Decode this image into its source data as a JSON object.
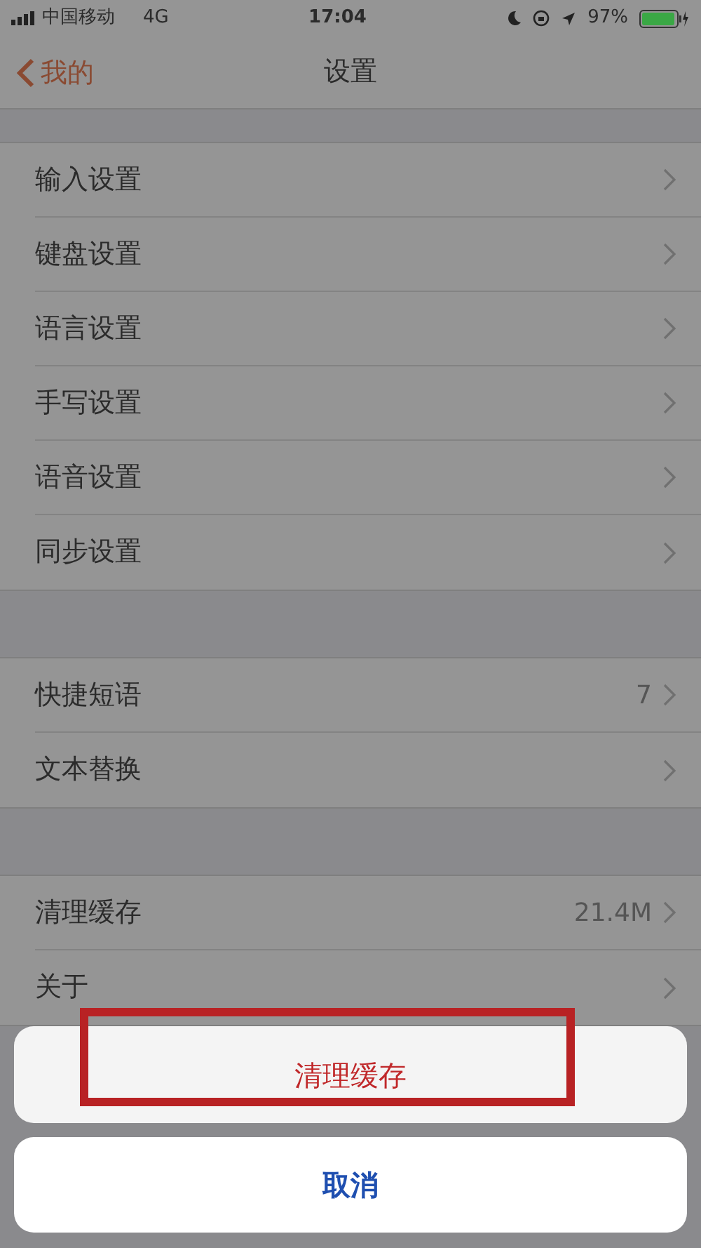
{
  "status_bar": {
    "carrier": "中国移动",
    "network": "4G",
    "time": "17:04",
    "battery": "97%"
  },
  "nav": {
    "back": "我的",
    "title": "设置"
  },
  "groups": [
    {
      "rows": [
        {
          "label": "输入设置"
        },
        {
          "label": "键盘设置"
        },
        {
          "label": "语言设置"
        },
        {
          "label": "手写设置"
        },
        {
          "label": "语音设置"
        },
        {
          "label": "同步设置"
        }
      ]
    },
    {
      "rows": [
        {
          "label": "快捷短语",
          "value": "7"
        },
        {
          "label": "文本替换"
        }
      ]
    },
    {
      "rows": [
        {
          "label": "清理缓存",
          "value": "21.4M"
        },
        {
          "label": "关于"
        }
      ]
    }
  ],
  "action_sheet": {
    "actions": [
      {
        "label": "清理缓存",
        "kind": "destructive",
        "highlighted": true
      }
    ],
    "cancel": "取消"
  }
}
